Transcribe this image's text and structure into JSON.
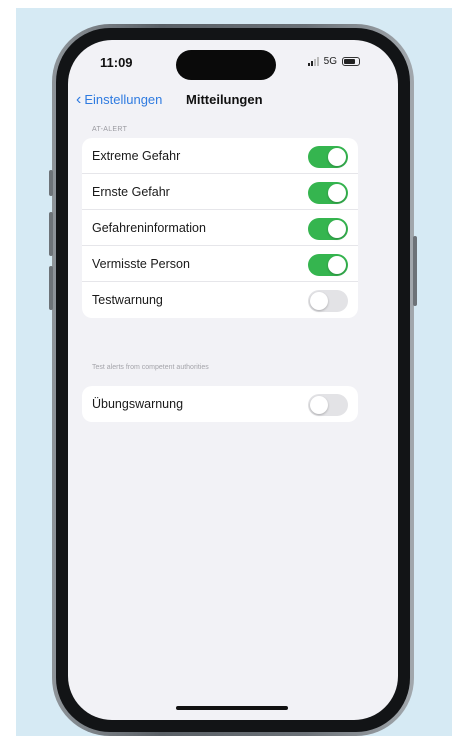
{
  "status_bar": {
    "time": "11:09",
    "network": "5G"
  },
  "nav": {
    "back_label": "Einstellungen",
    "title": "Mitteilungen"
  },
  "alerts_section": {
    "header": "AT-ALERT",
    "items": [
      {
        "label": "Extreme Gefahr",
        "on": true
      },
      {
        "label": "Ernste Gefahr",
        "on": true
      },
      {
        "label": "Gefahreninformation",
        "on": true
      },
      {
        "label": "Vermisste Person",
        "on": true
      },
      {
        "label": "Testwarnung",
        "on": false
      }
    ],
    "footer": "Test alerts from competent authorities"
  },
  "practice_section": {
    "items": [
      {
        "label": "Übungswarnung",
        "on": false
      }
    ]
  },
  "colors": {
    "toggle_on": "#35b54f",
    "link": "#2f7be0",
    "panel": "#d6eaf4"
  }
}
